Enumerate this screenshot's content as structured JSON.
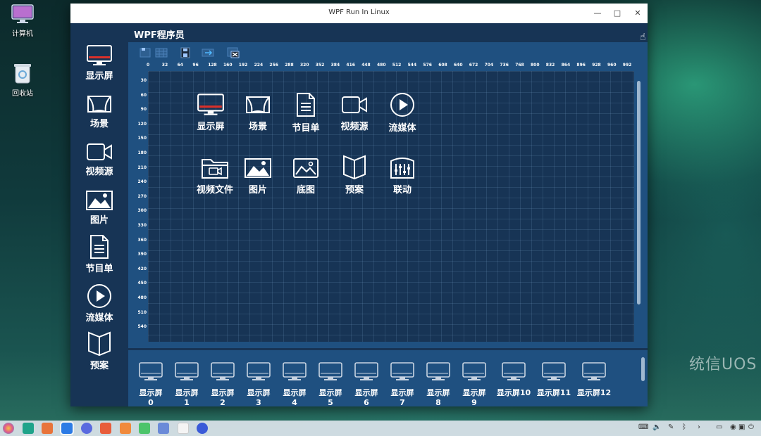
{
  "desktop": {
    "icons": [
      {
        "label": "计算机"
      },
      {
        "label": "回收站"
      }
    ],
    "watermark": "统信UOS"
  },
  "window": {
    "title": "WPF Run In Linux",
    "controls": {
      "minimize": "—",
      "maximize": "□",
      "close": "✕"
    }
  },
  "app": {
    "title": "WPF程序员"
  },
  "sidebar": {
    "items": [
      {
        "label": "显示屏",
        "icon": "monitor-icon"
      },
      {
        "label": "场景",
        "icon": "scene-icon"
      },
      {
        "label": "视频源",
        "icon": "video-camera-icon"
      },
      {
        "label": "图片",
        "icon": "image-icon"
      },
      {
        "label": "节目单",
        "icon": "document-icon"
      },
      {
        "label": "流媒体",
        "icon": "play-circle-icon"
      },
      {
        "label": "预案",
        "icon": "book-icon"
      }
    ]
  },
  "toolbar": {
    "tools": [
      "new-icon",
      "grid-icon",
      "save-icon",
      "export-icon",
      "delete-icon"
    ]
  },
  "ruler": {
    "top": [
      "0",
      "32",
      "64",
      "96",
      "128",
      "160",
      "192",
      "224",
      "256",
      "288",
      "320",
      "352",
      "384",
      "416",
      "448",
      "480",
      "512",
      "544",
      "576",
      "608",
      "640",
      "672",
      "704",
      "736",
      "768",
      "800",
      "832",
      "864",
      "896",
      "928",
      "960",
      "992"
    ],
    "left": [
      "30",
      "60",
      "90",
      "120",
      "150",
      "180",
      "210",
      "240",
      "270",
      "300",
      "330",
      "360",
      "390",
      "420",
      "450",
      "480",
      "510",
      "540"
    ]
  },
  "canvas": {
    "items": [
      {
        "label": "显示屏",
        "icon": "monitor-icon"
      },
      {
        "label": "场景",
        "icon": "scene-icon"
      },
      {
        "label": "节目单",
        "icon": "document-icon"
      },
      {
        "label": "视频源",
        "icon": "video-camera-icon"
      },
      {
        "label": "流媒体",
        "icon": "play-circle-icon"
      },
      {
        "label": "视频文件",
        "icon": "video-folder-icon"
      },
      {
        "label": "图片",
        "icon": "image-icon"
      },
      {
        "label": "底图",
        "icon": "base-image-icon"
      },
      {
        "label": "预案",
        "icon": "book-icon"
      },
      {
        "label": "联动",
        "icon": "linkage-icon"
      }
    ]
  },
  "screens": {
    "items": [
      "显示屏0",
      "显示屏1",
      "显示屏2",
      "显示屏3",
      "显示屏4",
      "显示屏5",
      "显示屏6",
      "显示屏7",
      "显示屏8",
      "显示屏9",
      "显示屏10",
      "显示屏11",
      "显示屏12"
    ]
  },
  "colors": {
    "window_bg": "#173455",
    "canvas_bg": "#1f5080",
    "accent_red": "#d9302a"
  }
}
